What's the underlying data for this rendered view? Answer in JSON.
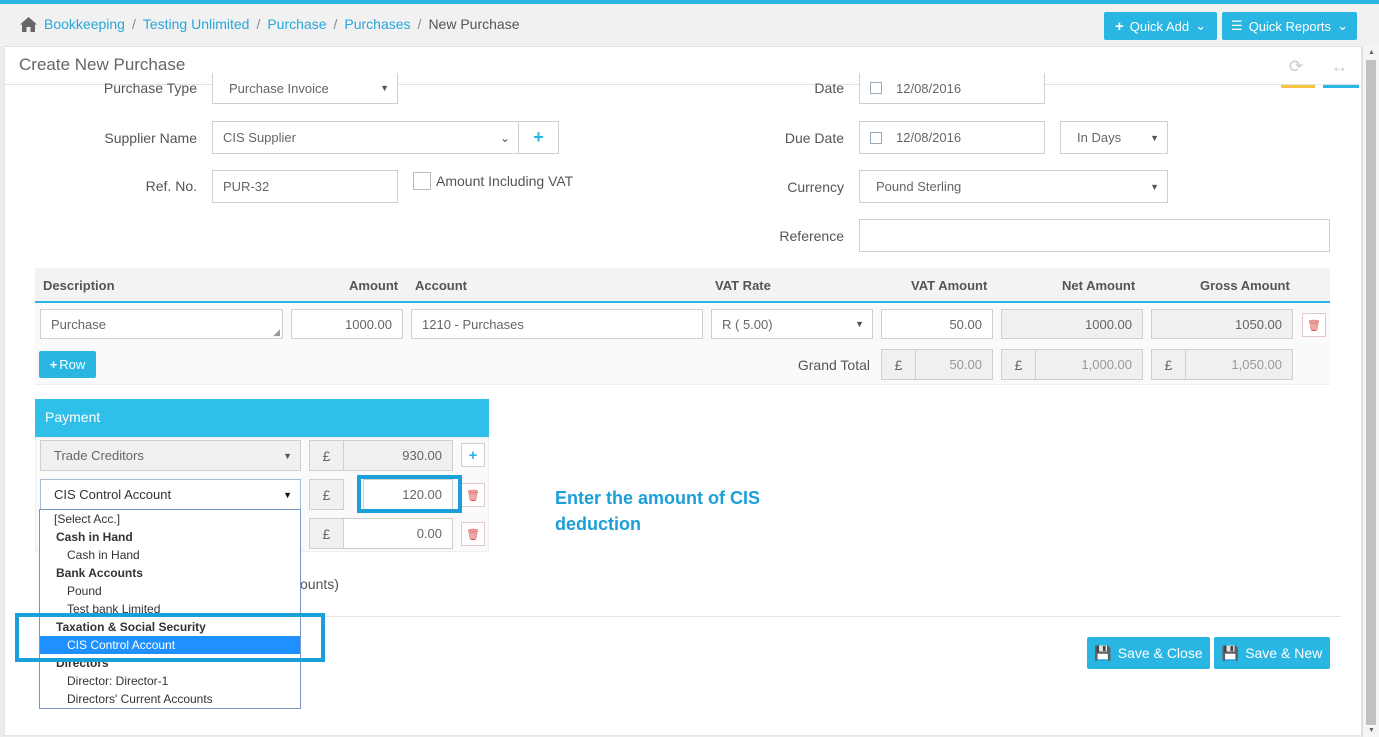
{
  "breadcrumb": {
    "items": [
      "Bookkeeping",
      "Testing Unlimited",
      "Purchase",
      "Purchases"
    ],
    "current": "New Purchase"
  },
  "toolbar": {
    "quick_add": "Quick Add",
    "quick_reports": "Quick Reports"
  },
  "page": {
    "title": "Create New Purchase"
  },
  "form": {
    "purchase_type": {
      "label": "Purchase Type",
      "value": "Purchase Invoice"
    },
    "supplier_name": {
      "label": "Supplier Name",
      "value": "CIS Supplier"
    },
    "ref_no": {
      "label": "Ref. No.",
      "value": "PUR-32"
    },
    "amount_incl_vat": {
      "label": "Amount Including VAT"
    },
    "date": {
      "label": "Date",
      "value": "12/08/2016"
    },
    "due_date": {
      "label": "Due Date",
      "value": "12/08/2016",
      "terms": "In Days"
    },
    "currency": {
      "label": "Currency",
      "value": "Pound Sterling"
    },
    "reference": {
      "label": "Reference",
      "value": ""
    }
  },
  "table": {
    "headers": [
      "Description",
      "Amount",
      "Account",
      "VAT Rate",
      "VAT Amount",
      "Net Amount",
      "Gross Amount"
    ],
    "rows": [
      {
        "description": "Purchase",
        "amount": "1000.00",
        "account": "1210 - Purchases",
        "vat_rate": "R ( 5.00)",
        "vat_amount": "50.00",
        "net_amount": "1000.00",
        "gross_amount": "1050.00"
      }
    ],
    "add_row": "Row",
    "grand_total_label": "Grand Total",
    "currency_symbol": "£",
    "totals": {
      "vat": "50.00",
      "net": "1,000.00",
      "gross": "1,050.00"
    }
  },
  "payment": {
    "title": "Payment",
    "lines": [
      {
        "account": "Trade Creditors",
        "amount": "930.00"
      },
      {
        "account": "CIS Control Account",
        "amount": "120.00"
      },
      {
        "account": "",
        "amount": "0.00"
      }
    ],
    "hidden_text": "ounts)"
  },
  "dropdown": {
    "items": [
      {
        "type": "opt0",
        "label": "[Select Acc.]"
      },
      {
        "type": "grp",
        "label": "Cash in Hand"
      },
      {
        "type": "opt",
        "label": "Cash in Hand"
      },
      {
        "type": "grp",
        "label": "Bank Accounts"
      },
      {
        "type": "opt",
        "label": "Pound"
      },
      {
        "type": "opt",
        "label": "Test bank Limited"
      },
      {
        "type": "grp",
        "label": "Taxation & Social Security"
      },
      {
        "type": "sel",
        "label": "CIS Control Account"
      },
      {
        "type": "grp",
        "label": "Directors"
      },
      {
        "type": "opt",
        "label": "Director: Director-1"
      },
      {
        "type": "opt",
        "label": "Directors' Current Accounts"
      }
    ]
  },
  "annotation": {
    "text": "Enter the amount of CIS deduction"
  },
  "actions": {
    "save_close": "Save & Close",
    "save_new": "Save & New"
  },
  "colors": {
    "accent": "#29b6e2",
    "highlight": "#1b9fd9",
    "delete": "#d9534f"
  }
}
